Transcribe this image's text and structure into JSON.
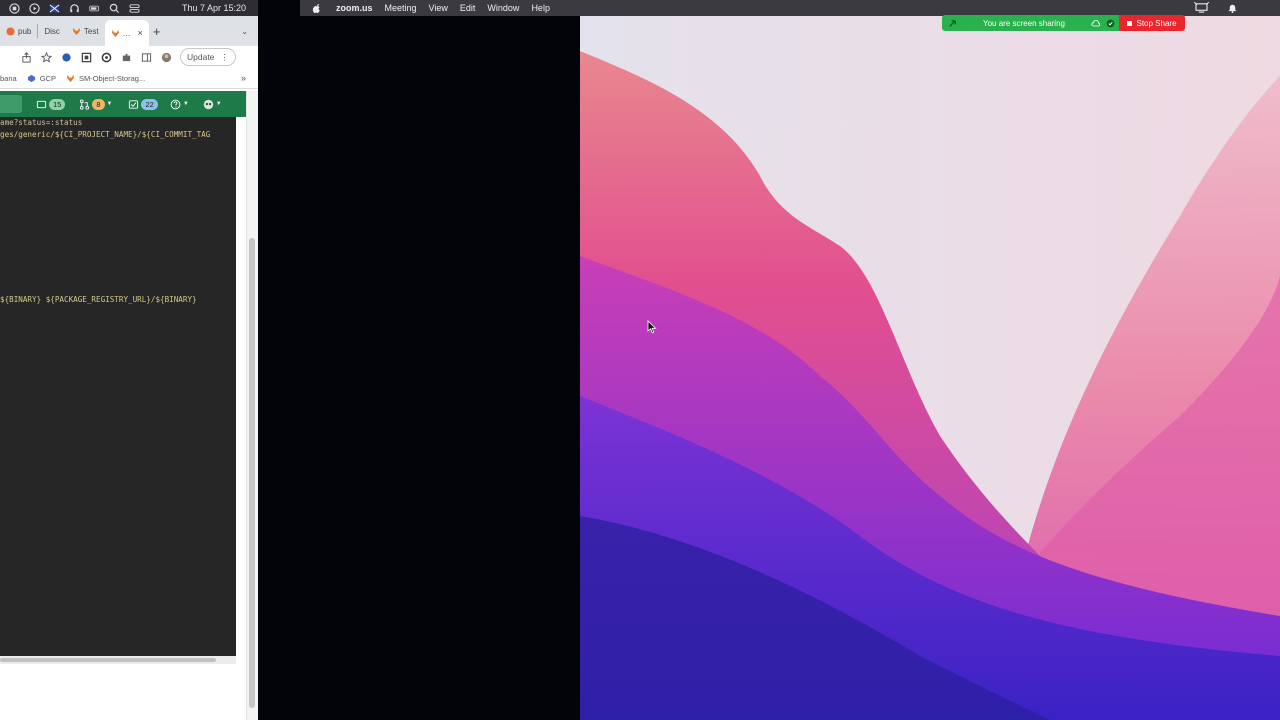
{
  "left": {
    "clock": "Thu 7 Apr  15:20",
    "tabs": [
      {
        "label": "pub",
        "icon": "github-icon"
      },
      {
        "label": "Disc",
        "icon": "discord-icon"
      },
      {
        "label": "Test",
        "icon": "gitlab-icon"
      },
      {
        "label": "…",
        "icon": "gitlab-icon"
      }
    ],
    "toolbar": {
      "update_label": "Update"
    },
    "bookmarks": [
      {
        "label": "bana",
        "icon": ""
      },
      {
        "label": "GCP",
        "icon": "gcp-icon"
      },
      {
        "label": "SM-Object-Storag...",
        "icon": "gitlab-icon"
      }
    ],
    "bookmarks_more": "»",
    "gitlab": {
      "issues_count": "15",
      "mr_count": "8",
      "todo_count": "22"
    },
    "code_lines": [
      "ame?status=:status",
      "ges/generic/${CI_PROJECT_NAME}/${CI_COMMIT_TAG",
      "${BINARY} ${PACKAGE_REGISTRY_URL}/${BINARY}"
    ],
    "colors": {
      "gitlab_green": "#1f7a4a",
      "code_bg": "#262626"
    }
  },
  "zoom": {
    "menu": {
      "app": "zoom.us",
      "items": [
        "Meeting",
        "View",
        "Edit",
        "Window",
        "Help"
      ]
    },
    "share_bar": {
      "status_text": "You are screen sharing",
      "stop_label": "Stop Share",
      "colors": {
        "green": "#28b14c",
        "red": "#e8262d"
      }
    }
  }
}
